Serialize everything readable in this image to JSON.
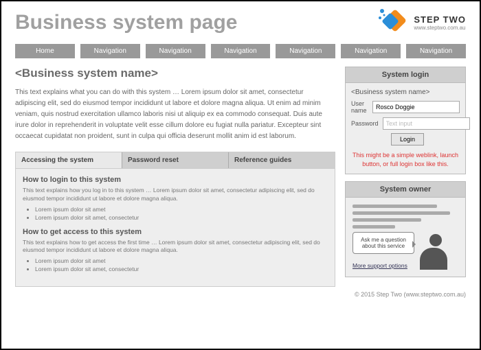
{
  "header": {
    "title": "Business system page",
    "logo_name": "STEP TWO",
    "logo_url": "www.steptwo.com.au"
  },
  "nav": [
    "Home",
    "Navigation",
    "Navigation",
    "Navigation",
    "Navigation",
    "Navigation",
    "Navigation"
  ],
  "main": {
    "subtitle": "<Business system name>",
    "intro": "This text explains what you can do with this system … Lorem ipsum dolor sit amet, consectetur adipiscing elit, sed do eiusmod tempor incididunt ut labore et dolore magna aliqua. Ut enim ad minim veniam, quis nostrud exercitation ullamco laboris nisi ut aliquip ex ea commodo consequat. Duis aute irure dolor in reprehenderit in voluptate velit esse cillum dolore eu fugiat nulla pariatur. Excepteur sint occaecat cupidatat non proident, sunt in culpa qui officia deserunt mollit anim id est laborum.",
    "tabs": [
      "Accessing the system",
      "Password reset",
      "Reference guides"
    ],
    "sec1_title": "How to login to this system",
    "sec1_text": "This text explains how you log in to this system … Lorem ipsum dolor sit amet, consectetur adipiscing elit, sed do eiusmod tempor incididunt ut labore et dolore magna aliqua.",
    "sec1_b1": "Lorem ipsum dolor sit amet",
    "sec1_b2": "Lorem ipsum dolor sit amet, consectetur",
    "sec2_title": "How to get access to this system",
    "sec2_text": "This text explains how to get access the first time … Lorem ipsum dolor sit amet, consectetur adipiscing elit, sed do eiusmod tempor incididunt ut labore et dolore magna aliqua.",
    "sec2_b1": "Lorem ipsum dolor sit amet",
    "sec2_b2": "Lorem ipsum dolor sit amet, consectetur"
  },
  "login": {
    "title": "System login",
    "sysname": "<Business system name>",
    "user_label": "User name",
    "user_value": "Rosco Doggie",
    "pass_label": "Password",
    "pass_placeholder": "Text input",
    "button": "Login",
    "note": "This might be a simple weblink, launch button, or full login box like this."
  },
  "owner": {
    "title": "System owner",
    "bubble": "Ask me a question about this service",
    "support_link": "More support options"
  },
  "footer": "© 2015 Step Two (www.steptwo.com.au)"
}
